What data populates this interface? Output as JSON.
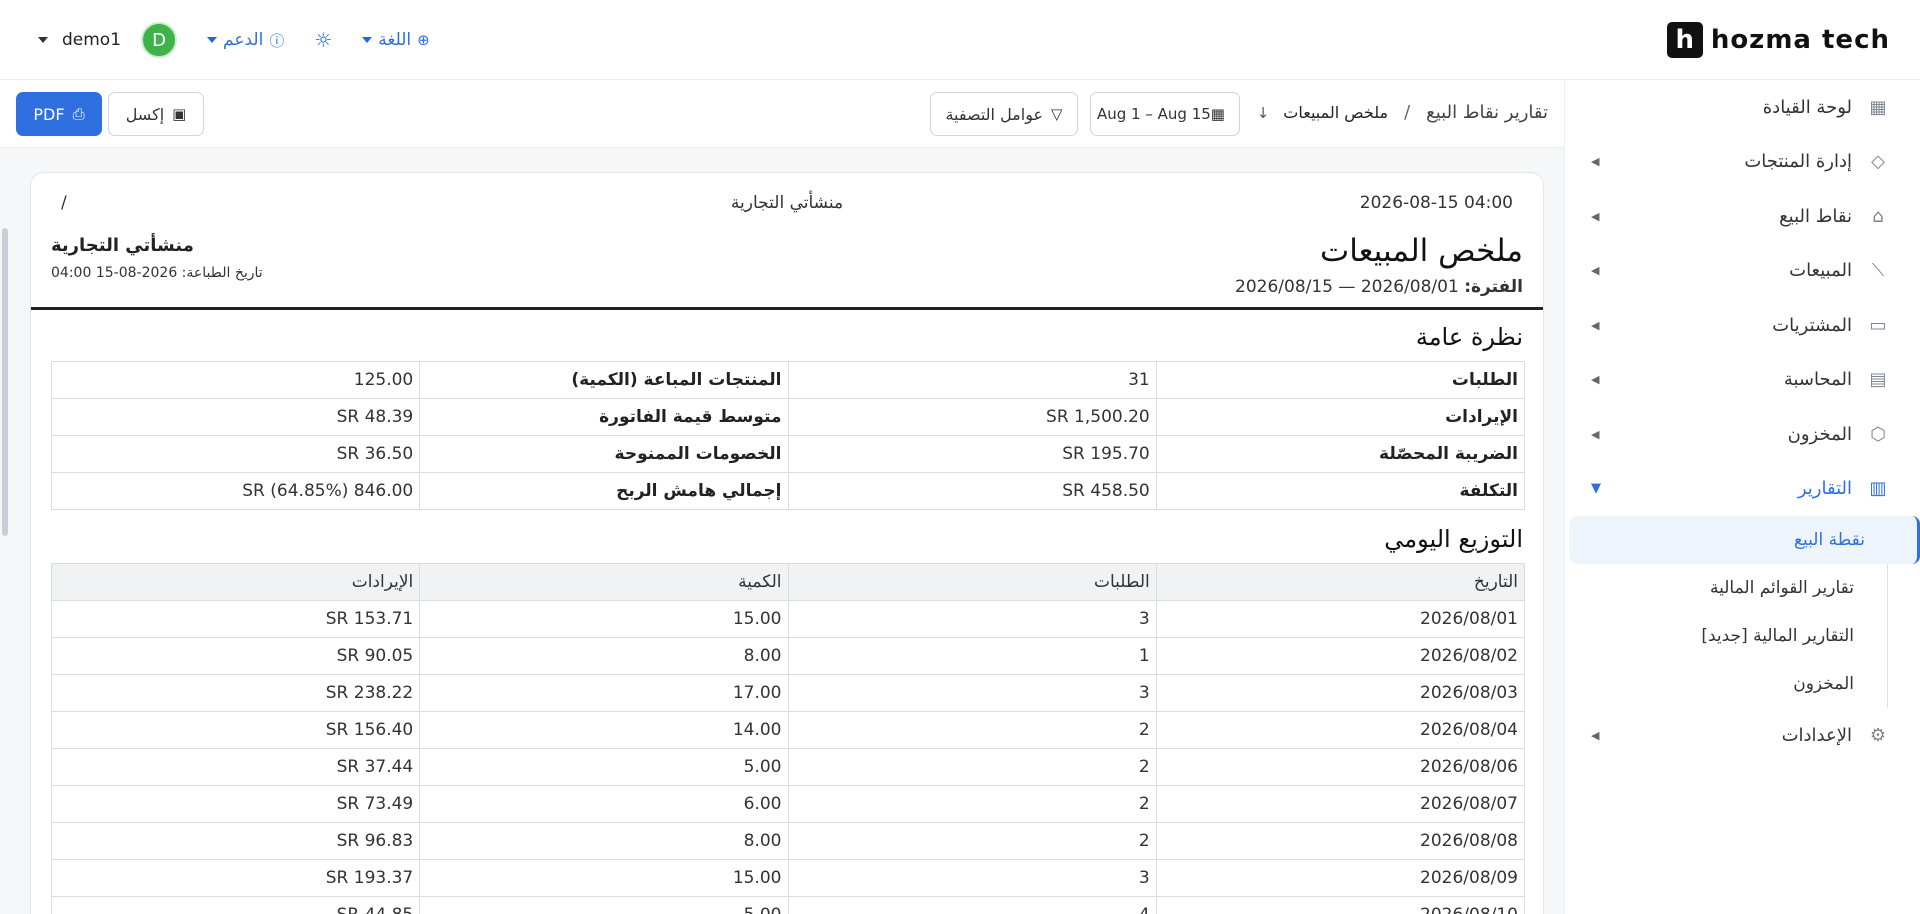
{
  "brand": {
    "name": "hozma tech",
    "mark": "h"
  },
  "header": {
    "user_name": "demo1",
    "avatar_initial": "D",
    "support_label": "الدعم",
    "language_label": "اللغة"
  },
  "sidebar": {
    "items": [
      {
        "label": "لوحة القيادة"
      },
      {
        "label": "إدارة المنتجات"
      },
      {
        "label": "نقاط البيع"
      },
      {
        "label": "المبيعات"
      },
      {
        "label": "المشتريات"
      },
      {
        "label": "المحاسبة"
      },
      {
        "label": "المخزون"
      },
      {
        "label": "التقارير"
      },
      {
        "label": "الإعدادات"
      }
    ],
    "sub_items": [
      {
        "label": "نقطة البيع"
      },
      {
        "label": "تقارير القوائم المالية"
      },
      {
        "label": "التقارير المالية [جديد]"
      },
      {
        "label": "المخزون"
      }
    ]
  },
  "toolbar": {
    "breadcrumb_root": "تقارير نقاط البيع",
    "breadcrumb_sep": "/",
    "breadcrumb_current": "ملخص المبيعات",
    "date_range": "Aug 1 – Aug 15",
    "filter_label": "عوامل التصفية",
    "excel_label": "إكسل",
    "pdf_label": "PDF"
  },
  "report": {
    "header_datetime": "2026-08-15 04:00",
    "header_company": "منشأتي التجارية",
    "header_page": "/",
    "title": "ملخص المبيعات",
    "period_label": "الفترة:",
    "period_value": "2026/08/01 — 2026/08/15",
    "company_name": "منشأتي التجارية",
    "printed_at": "تاريخ الطباعة: 2026-08-15 04:00",
    "overview_title": "نظرة عامة",
    "overview": [
      {
        "label1": "الطلبات",
        "value1": "31",
        "label2": "المنتجات المباعة (الكمية)",
        "value2": "125.00"
      },
      {
        "label1": "الإيرادات",
        "value1": "SR 1,500.20",
        "label2": "متوسط قيمة الفاتورة",
        "value2": "SR 48.39"
      },
      {
        "label1": "الضريبة المحصّلة",
        "value1": "SR 195.70",
        "label2": "الخصومات الممنوحة",
        "value2": "SR 36.50"
      },
      {
        "label1": "التكلفة",
        "value1": "SR 458.50",
        "label2": "إجمالي هامش الربح",
        "value2": "SR (64.85%) 846.00"
      }
    ],
    "daily_title": "التوزيع اليومي",
    "daily_columns": [
      "التاريخ",
      "الطلبات",
      "الكمية",
      "الإيرادات"
    ],
    "daily_rows": [
      [
        "2026/08/01",
        "3",
        "15.00",
        "SR 153.71"
      ],
      [
        "2026/08/02",
        "1",
        "8.00",
        "SR 90.05"
      ],
      [
        "2026/08/03",
        "3",
        "17.00",
        "SR 238.22"
      ],
      [
        "2026/08/04",
        "2",
        "14.00",
        "SR 156.40"
      ],
      [
        "2026/08/06",
        "2",
        "5.00",
        "SR 37.44"
      ],
      [
        "2026/08/07",
        "2",
        "6.00",
        "SR 73.49"
      ],
      [
        "2026/08/08",
        "2",
        "8.00",
        "SR 96.83"
      ],
      [
        "2026/08/09",
        "3",
        "15.00",
        "SR 193.37"
      ],
      [
        "2026/08/10",
        "4",
        "5.00",
        "SR 44.85"
      ]
    ]
  }
}
